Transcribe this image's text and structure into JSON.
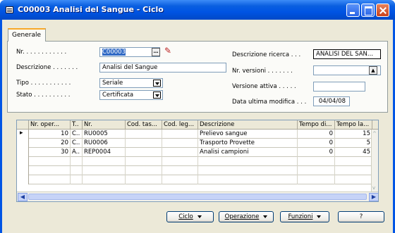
{
  "window": {
    "title": "C00003 Analisi del Sangue - Ciclo"
  },
  "tabs": [
    {
      "label": "Generale"
    }
  ],
  "form": {
    "nr_label": "Nr. . . . . . . . . . . .",
    "nr_value": "C00003",
    "descrizione_label": "Descrizione . . . . . . .",
    "descrizione_value": "Analisi del Sangue",
    "tipo_label": "Tipo . . . . . . . . . . .",
    "tipo_value": "Seriale",
    "stato_label": "Stato . . . . . . . . . .",
    "stato_value": "Certificata",
    "descr_ricerca_label": "Descrizione ricerca . . .",
    "descr_ricerca_value": "ANALISI DEL SAN...",
    "nr_versioni_label": "Nr. versioni . . . . . . .",
    "nr_versioni_value": "",
    "versione_attiva_label": "Versione attiva . . . . .",
    "versione_attiva_value": "",
    "data_modifica_label": "Data ultima modifica . . .",
    "data_modifica_value": "04/04/08"
  },
  "table": {
    "columns": [
      "Nr. oper...",
      "T..",
      "Nr.",
      "Cod. tas...",
      "Cod. leg...",
      "Descrizione",
      "Tempo di...",
      "Tempo la..."
    ],
    "rows": [
      [
        "10",
        "C..",
        "RU0005",
        "",
        "",
        "Prelievo sangue",
        "0",
        "15"
      ],
      [
        "20",
        "C..",
        "RU0006",
        "",
        "",
        "Trasporto Provette",
        "0",
        "5"
      ],
      [
        "30",
        "A..",
        "REP0004",
        "",
        "",
        "Analisi campioni",
        "0",
        "45"
      ]
    ]
  },
  "buttons": {
    "ciclo": "Ciclo",
    "operazione": "Operazione",
    "funzioni": "Funzioni",
    "help": "?"
  }
}
